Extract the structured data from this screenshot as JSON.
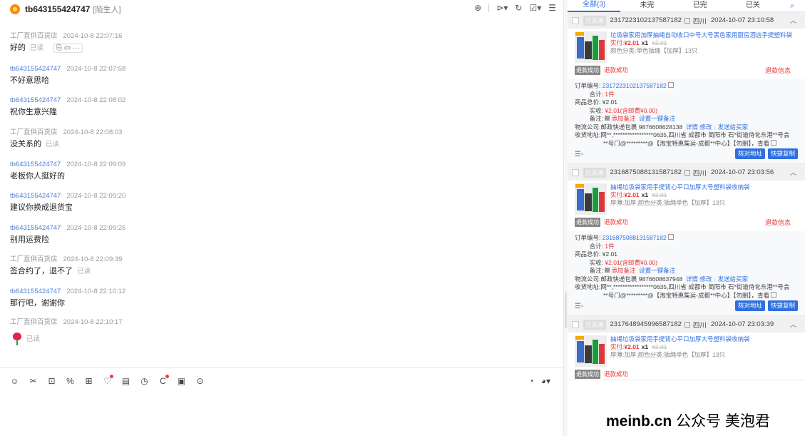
{
  "header": {
    "name": "tb643155424747",
    "tag": "[陌生人]"
  },
  "messages": [
    {
      "sender": "工厂直供百货店",
      "time": "2024-10-8 22:07:16",
      "text": "好的",
      "read": "已读",
      "seller": true,
      "quick": "⎘ ▭ ···"
    },
    {
      "sender": "tb643155424747",
      "time": "2024-10-8 22:07:58",
      "text": "不好意思哈",
      "read": "",
      "seller": false
    },
    {
      "sender": "tb643155424747",
      "time": "2024-10-8 22:08:02",
      "text": "祝你生意兴隆",
      "read": "",
      "seller": false
    },
    {
      "sender": "工厂直供百货店",
      "time": "2024-10-8 22:08:03",
      "text": "没关系的",
      "read": "已读",
      "seller": true
    },
    {
      "sender": "tb643155424747",
      "time": "2024-10-8 22:09:09",
      "text": "老板你人挺好的",
      "read": "",
      "seller": false
    },
    {
      "sender": "tb643155424747",
      "time": "2024-10-8 22:09:20",
      "text": "建议你换成退货宝",
      "read": "",
      "seller": false
    },
    {
      "sender": "tb643155424747",
      "time": "2024-10-8 22:09:26",
      "text": "别用运费险",
      "read": "",
      "seller": false
    },
    {
      "sender": "工厂直供百货店",
      "time": "2024-10-8 22:09:39",
      "text": "签合约了，退不了",
      "read": "已读",
      "seller": true
    },
    {
      "sender": "tb643155424747",
      "time": "2024-10-8 22:10:12",
      "text": "那行吧，谢谢你",
      "read": "",
      "seller": false
    },
    {
      "sender": "工厂直供百货店",
      "time": "2024-10-8 22:10:17",
      "text": "",
      "read": "已读",
      "seller": true,
      "rose": true
    }
  ],
  "tabs": [
    "全部(3)",
    "未完",
    "已完",
    "已关"
  ],
  "orders": [
    {
      "status": "已关闭",
      "id": "2317223102137587182",
      "province": "四川",
      "time": "2024-10-07 23:10:58",
      "product": "垃圾袋家用加厚抽绳自动收口中号大号黑色家用厨房酒店手提塑料袋",
      "paid_label": "实付:",
      "paid": "¥2.01",
      "qty": "x1",
      "orig": "¥2.01",
      "spec": "颜色分类:单色抽绳【加厚】13只",
      "refund_badge": "退款成功",
      "refund_text": "退款成功",
      "refund_info": "退款信息",
      "order_no_label": "订单编号:",
      "order_no": "2317223102137587182",
      "total_label": "合计:",
      "total": "1件",
      "goods_total_label": "商品总价:",
      "goods_total": "¥2.01",
      "actual_label": "实收:",
      "actual": "¥2.01(含邮费¥0.00)",
      "note_label": "备注:",
      "note_add": "添加备注",
      "note_set": "设置一键备注",
      "logistics_label": "物流公司:",
      "logistics": "邮政快递包裹 9876608628138",
      "logistics_detail": "详情",
      "logistics_edit": "修改",
      "logistics_send": "发送给买家",
      "address_label": "收货地址:",
      "address": "网**,*****************0635,四川省 成都市 简阳市 石*街道侍化东港**号会",
      "address2": "**号门@*********@【淘宝特惠集运-成都**中心】【勿删】，查看",
      "btn1": "核对地址",
      "btn2": "快捷复制"
    },
    {
      "status": "已关闭",
      "id": "2316875088131587182",
      "province": "四川",
      "time": "2024-10-07 23:03:56",
      "product": "抽绳垃圾袋家用手提背心平口加厚大号塑料袋收纳袋",
      "paid_label": "实付:",
      "paid": "¥2.01",
      "qty": "x1",
      "orig": "¥2.01",
      "spec": "厚薄:加厚;颜色分类:抽绳单色【加厚】13只",
      "refund_badge": "退款成功",
      "refund_text": "退款成功",
      "refund_info": "退款信息",
      "order_no_label": "订单编号:",
      "order_no": "2316875088131587182",
      "total_label": "合计:",
      "total": "1件",
      "goods_total_label": "商品总价:",
      "goods_total": "¥2.01",
      "actual_label": "实收:",
      "actual": "¥2.01(含邮费¥0.00)",
      "note_label": "备注:",
      "note_add": "添加备注",
      "note_set": "设置一键备注",
      "logistics_label": "物流公司:",
      "logistics": "邮政快递包裹 9876608637948",
      "logistics_detail": "详情",
      "logistics_edit": "修改",
      "logistics_send": "发送给买家",
      "address_label": "收货地址:",
      "address": "网**,*****************0635,四川省 成都市 简阳市 石*街道侍化东港**号会",
      "address2": "**号门@*********@【淘宝特惠集运-成都**中心】【勿删】，查看",
      "btn1": "核对地址",
      "btn2": "快捷复制"
    },
    {
      "status": "已关闭",
      "id": "2317648945996587182",
      "province": "四川",
      "time": "2024-10-07 23:03:39",
      "product": "抽绳垃圾袋家用手提背心平口加厚大号塑料袋收纳袋",
      "paid_label": "实付:",
      "paid": "¥2.01",
      "qty": "x1",
      "orig": "¥2.01",
      "spec": "厚薄:加厚;颜色分类:抽绳单色【加厚】13只",
      "refund_badge": "退款成功",
      "refund_text": "退款成功"
    }
  ],
  "overlay": {
    "site": "meinb.cn",
    "text": "公众号 美泡君"
  }
}
